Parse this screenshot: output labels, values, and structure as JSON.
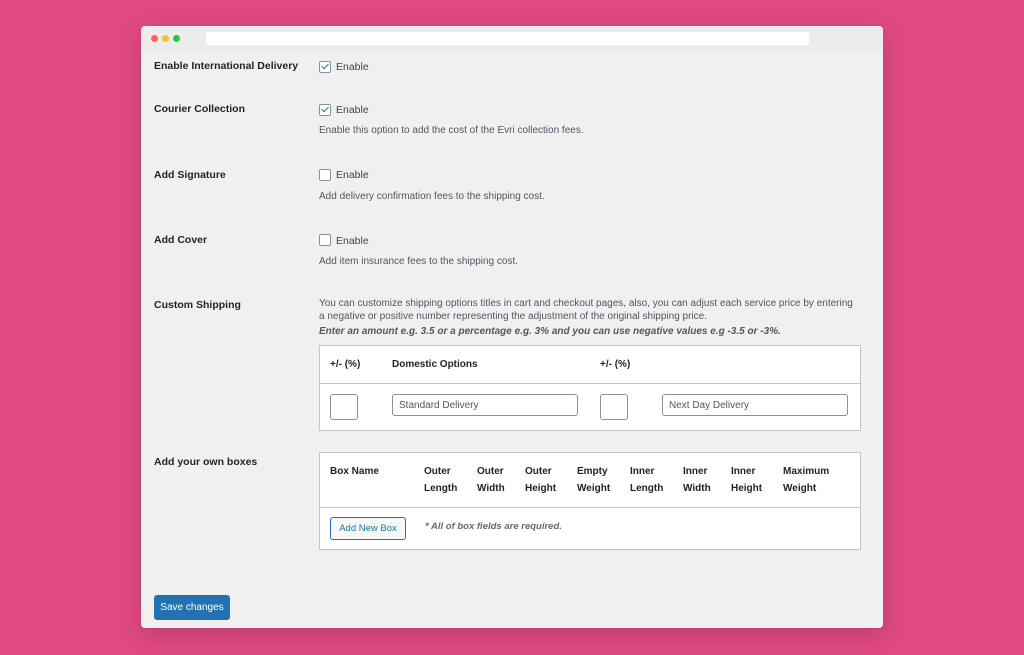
{
  "window": {
    "title_url": ""
  },
  "settings": {
    "intl_delivery": {
      "label": "Enable International Delivery",
      "checkbox_label": "Enable",
      "checked": true
    },
    "courier_collection": {
      "label": "Courier Collection",
      "checkbox_label": "Enable",
      "checked": true,
      "description": "Enable this option to add the cost of the Evri collection fees."
    },
    "add_signature": {
      "label": "Add Signature",
      "checkbox_label": "Enable",
      "checked": false,
      "description": "Add delivery confirmation fees to the shipping cost."
    },
    "add_cover": {
      "label": "Add Cover",
      "checkbox_label": "Enable",
      "checked": false,
      "description": "Add item insurance fees to the shipping cost."
    },
    "custom_shipping": {
      "label": "Custom Shipping",
      "description": "You can customize shipping options titles in cart and checkout pages, also, you can adjust each service price by entering a negative or positive number representing the adjustment of the original shipping price.",
      "note": "Enter an amount e.g. 3.5 or a percentage e.g. 3% and you can use negative values e.g -3.5 or -3%.",
      "headers": [
        "+/- (%)",
        "Domestic Options",
        "+/- (%)"
      ],
      "domestic_placeholder": "Standard Delivery",
      "next_day_placeholder": "Next Day Delivery"
    },
    "boxes": {
      "label": "Add your own boxes",
      "columns": [
        [
          "Box Name",
          ""
        ],
        [
          "Outer",
          "Length"
        ],
        [
          "Outer",
          "Width"
        ],
        [
          "Outer",
          "Height"
        ],
        [
          "Empty",
          "Weight"
        ],
        [
          "Inner",
          "Length"
        ],
        [
          "Inner",
          "Width"
        ],
        [
          "Inner",
          "Height"
        ],
        [
          "Maximum",
          "Weight"
        ]
      ],
      "add_button": "Add New Box",
      "required_note": "* All of box fields are required."
    }
  },
  "save_button": "Save changes"
}
